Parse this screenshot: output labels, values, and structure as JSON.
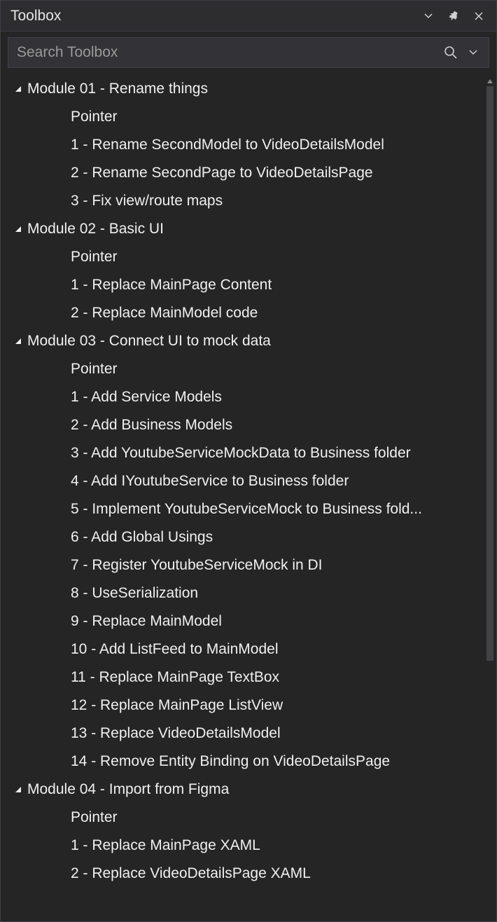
{
  "panel": {
    "title": "Toolbox"
  },
  "search": {
    "placeholder": "Search Toolbox",
    "value": ""
  },
  "modules": [
    {
      "label": "Module 01 - Rename things",
      "items": [
        "Pointer",
        "1 - Rename SecondModel to VideoDetailsModel",
        "2 - Rename SecondPage to VideoDetailsPage",
        "3 - Fix view/route maps"
      ]
    },
    {
      "label": "Module 02 - Basic UI",
      "items": [
        "Pointer",
        "1 - Replace MainPage Content",
        "2 - Replace MainModel code"
      ]
    },
    {
      "label": "Module 03 - Connect UI to mock data",
      "items": [
        "Pointer",
        "1 - Add Service Models",
        "2 - Add Business Models",
        "3 - Add YoutubeServiceMockData to Business folder",
        "4 - Add IYoutubeService to Business folder",
        "5 - Implement YoutubeServiceMock to Business fold...",
        "6 - Add Global Usings",
        "7 - Register YoutubeServiceMock in DI",
        "8 - UseSerialization",
        "9 - Replace MainModel",
        "10 - Add ListFeed to MainModel",
        "11 - Replace MainPage TextBox",
        "12 - Replace MainPage ListView",
        "13 - Replace VideoDetailsModel",
        "14 - Remove Entity Binding on VideoDetailsPage"
      ]
    },
    {
      "label": "Module 04 - Import from Figma",
      "items": [
        "Pointer",
        "1 - Replace MainPage XAML",
        "2 - Replace VideoDetailsPage XAML"
      ]
    }
  ]
}
